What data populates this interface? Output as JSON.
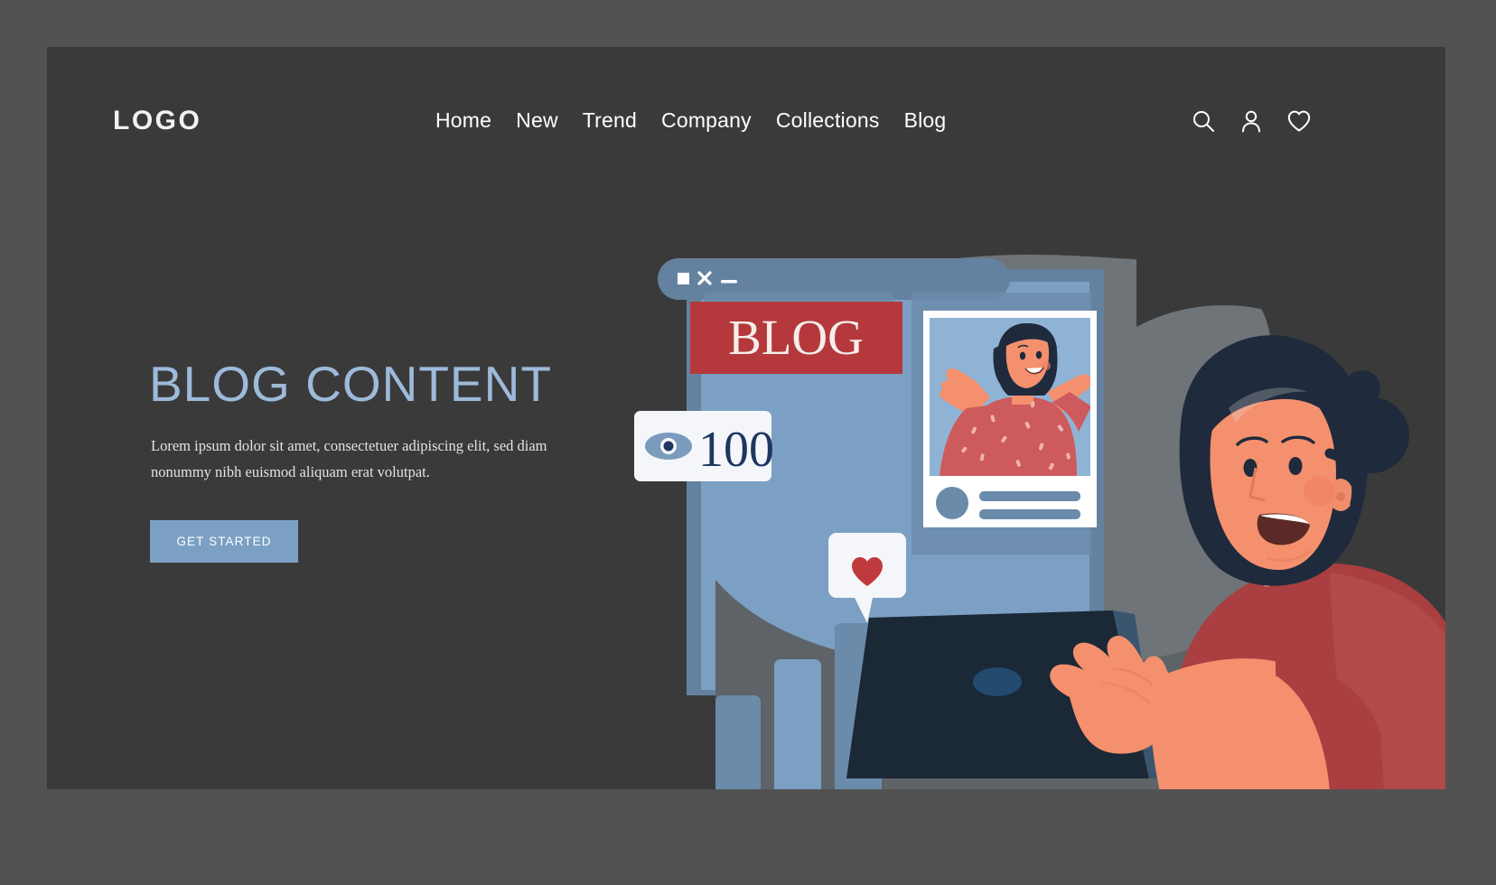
{
  "header": {
    "logo": "LOGO",
    "nav": [
      {
        "label": "Home"
      },
      {
        "label": "New"
      },
      {
        "label": "Trend"
      },
      {
        "label": "Company"
      },
      {
        "label": "Collections"
      },
      {
        "label": "Blog"
      }
    ],
    "icons": [
      {
        "name": "search-icon"
      },
      {
        "name": "user-icon"
      },
      {
        "name": "heart-icon"
      }
    ]
  },
  "hero": {
    "headline": "BLOG CONTENT",
    "body": "Lorem ipsum dolor sit amet, consectetuer adipiscing elit, sed diam nonummy nibh euismod aliquam erat volutpat.",
    "cta_label": "GET STARTED"
  },
  "illustration": {
    "window_controls": {
      "maximize": "□",
      "close": "✕",
      "minimize": "—"
    },
    "blog_banner": "BLOG",
    "views_count": "100",
    "views_icon": "eye-icon",
    "like_icon": "heart-icon"
  },
  "colors": {
    "page_border": "#525252",
    "panel_bg": "#3a3a3a",
    "accent_blue": "#7ba0c4",
    "headline_blue": "#9dbada",
    "banner_red": "#b5393c",
    "heart_red": "#c0393c",
    "skin": "#f4906e",
    "hair_dark": "#1f2a3c",
    "laptop_dark": "#1b2836",
    "blob_gray": "#6f7479",
    "card_light": "#f4f6f9",
    "number_navy": "#1e3660",
    "shirt_red": "#a93f41"
  }
}
